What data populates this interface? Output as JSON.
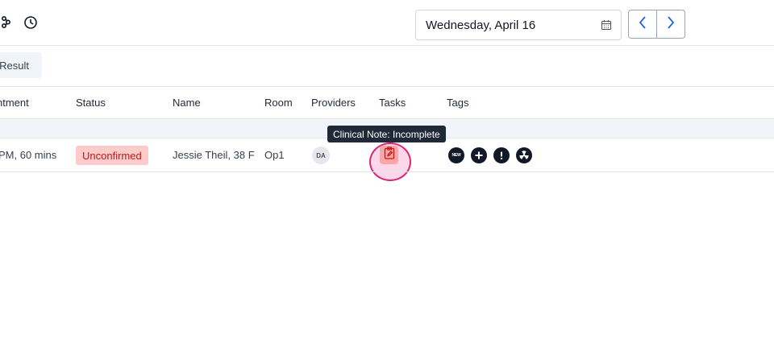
{
  "header": {
    "date": "Wednesday, April 16",
    "icons": [
      "people-network-icon",
      "clock-icon",
      "calendar-icon",
      "chevron-left-icon",
      "chevron-right-icon"
    ]
  },
  "toolbar": {
    "result_label": "Result"
  },
  "table": {
    "columns": [
      "ntment",
      "Status",
      "Name",
      "Room",
      "Providers",
      "Tasks",
      "Tags"
    ],
    "rows": [
      {
        "appointment": "PM, 60 mins",
        "status": "Unconfirmed",
        "name": "Jessie Theil, 38 F",
        "room": "Op1",
        "provider_initials": "DA",
        "tags": [
          "new-tag-icon",
          "plus-tag-icon",
          "alert-tag-icon",
          "radiation-tag-icon"
        ],
        "tag_new_text": "NEW"
      }
    ]
  },
  "tooltip": {
    "text": "Clinical Note: Incomplete"
  },
  "colors": {
    "status_bg": "#fecaca",
    "status_text": "#b91c1c",
    "accent": "#2563eb",
    "highlight": "#db2777"
  }
}
